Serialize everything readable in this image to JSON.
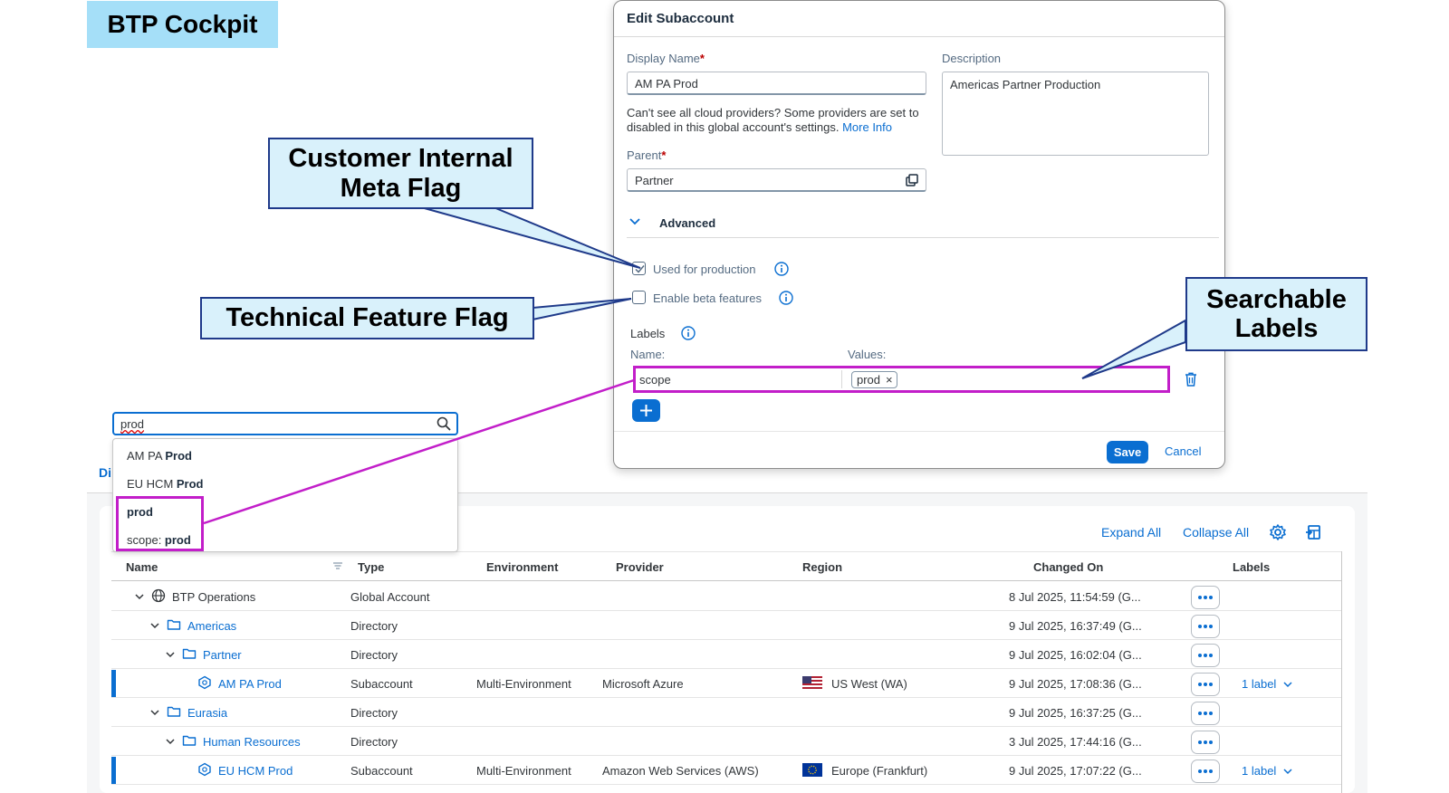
{
  "title_badge": "BTP Cockpit",
  "callouts": {
    "meta_flag": "Customer Internal Meta Flag",
    "technical_flag": "Technical Feature Flag",
    "searchable_labels": "Searchable Labels"
  },
  "search": {
    "value": "prod",
    "suggestions": [
      {
        "prefix": "AM PA ",
        "match": "Prod"
      },
      {
        "prefix": "EU HCM ",
        "match": "Prod"
      },
      {
        "prefix": "",
        "match": "prod"
      },
      {
        "prefix": "scope: ",
        "match": "prod"
      }
    ]
  },
  "tab_fragment": "Di",
  "toolbar": {
    "expand_all": "Expand All",
    "collapse_all": "Collapse All",
    "settings_icon": "gear-icon",
    "export_icon": "export-icon"
  },
  "table": {
    "columns": [
      "Name",
      "Type",
      "Environment",
      "Provider",
      "Region",
      "Changed On",
      "Labels"
    ],
    "rows": [
      {
        "name": "BTP Operations",
        "icon": "globe-icon",
        "level": 0,
        "type": "Global Account",
        "environment": "",
        "provider": "",
        "region": "",
        "flag": "",
        "changed_on": "8 Jul 2025, 11:54:59 (G...",
        "labels": "",
        "selected": false
      },
      {
        "name": "Americas",
        "icon": "folder-icon",
        "level": 1,
        "type": "Directory",
        "environment": "",
        "provider": "",
        "region": "",
        "flag": "",
        "changed_on": "9 Jul 2025, 16:37:49 (G...",
        "labels": "",
        "selected": false
      },
      {
        "name": "Partner",
        "icon": "folder-icon",
        "level": 2,
        "type": "Directory",
        "environment": "",
        "provider": "",
        "region": "",
        "flag": "",
        "changed_on": "9 Jul 2025, 16:02:04 (G...",
        "labels": "",
        "selected": false
      },
      {
        "name": "AM PA Prod",
        "icon": "subaccount-icon",
        "level": 3,
        "type": "Subaccount",
        "environment": "Multi-Environment",
        "provider": "Microsoft Azure",
        "region": "US West (WA)",
        "flag": "us",
        "changed_on": "9 Jul 2025, 17:08:36 (G...",
        "labels": "1 label",
        "selected": true
      },
      {
        "name": "Eurasia",
        "icon": "folder-icon",
        "level": 1,
        "type": "Directory",
        "environment": "",
        "provider": "",
        "region": "",
        "flag": "",
        "changed_on": "9 Jul 2025, 16:37:25 (G...",
        "labels": "",
        "selected": false
      },
      {
        "name": "Human Resources",
        "icon": "folder-icon",
        "level": 2,
        "type": "Directory",
        "environment": "",
        "provider": "",
        "region": "",
        "flag": "",
        "changed_on": "3 Jul 2025, 17:44:16 (G...",
        "labels": "",
        "selected": false
      },
      {
        "name": "EU HCM Prod",
        "icon": "subaccount-icon",
        "level": 3,
        "type": "Subaccount",
        "environment": "Multi-Environment",
        "provider": "Amazon Web Services (AWS)",
        "region": "Europe (Frankfurt)",
        "flag": "eu",
        "changed_on": "9 Jul 2025, 17:07:22 (G...",
        "labels": "1 label",
        "selected": true
      }
    ]
  },
  "dialog": {
    "title": "Edit Subaccount",
    "display_name_label": "Display Name",
    "display_name_value": "AM PA Prod",
    "description_label": "Description",
    "description_value": "Americas Partner Production",
    "hint_text": "Can't see all cloud providers? Some providers are set to disabled in this global account's settings.",
    "hint_link": "More Info",
    "parent_label": "Parent",
    "parent_value": "Partner",
    "required_mark": "*",
    "advanced_label": "Advanced",
    "used_for_production_label": "Used for production",
    "used_for_production_checked": true,
    "enable_beta_label": "Enable beta features",
    "enable_beta_checked": false,
    "labels_title": "Labels",
    "labels_name_col": "Name:",
    "labels_values_col": "Values:",
    "label_name": "scope",
    "label_value": "prod",
    "token_remove": "×",
    "save_label": "Save",
    "cancel_label": "Cancel"
  },
  "colors": {
    "accent": "#0a6ed1",
    "highlight": "#c21ec9",
    "badge_bg": "#a5dff8",
    "callout_bg": "#d9f1fb",
    "callout_border": "#1f3a8a"
  }
}
